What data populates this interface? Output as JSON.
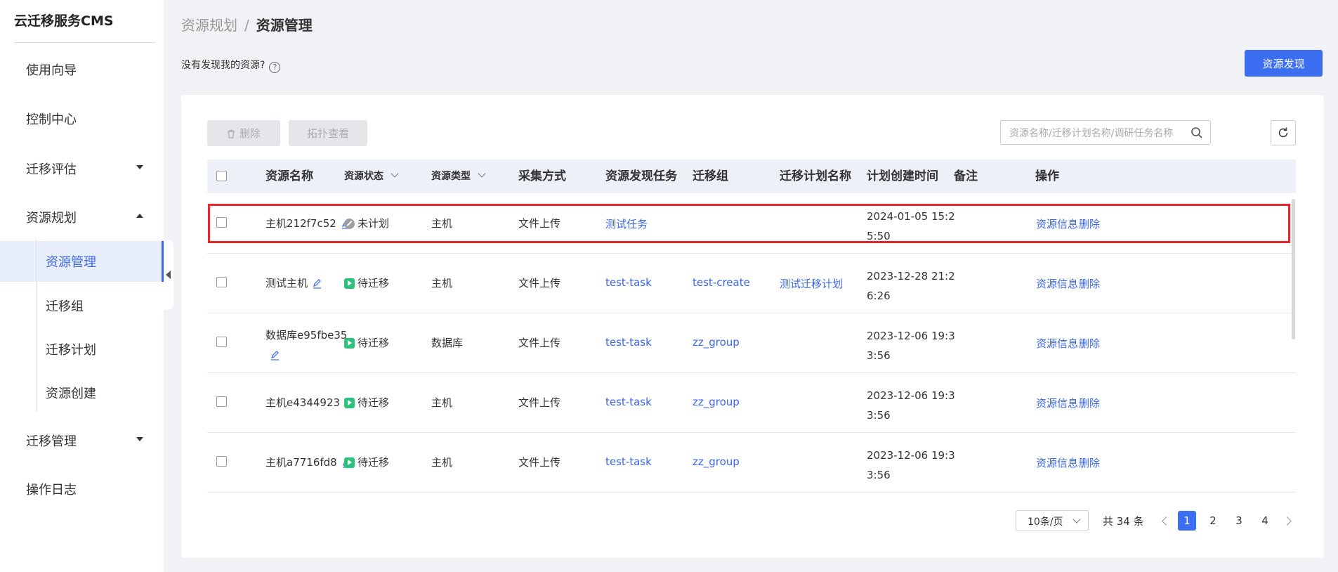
{
  "app": {
    "brand": "云迁移服务CMS"
  },
  "sidebar": {
    "items": [
      {
        "label": "使用向导"
      },
      {
        "label": "控制中心"
      },
      {
        "label": "迁移评估"
      },
      {
        "label": "资源规划"
      },
      {
        "label": "迁移管理"
      },
      {
        "label": "操作日志"
      }
    ],
    "sub_items": [
      {
        "label": "资源管理"
      },
      {
        "label": "迁移组"
      },
      {
        "label": "迁移计划"
      },
      {
        "label": "资源创建"
      }
    ]
  },
  "breadcrumb": {
    "parent": "资源规划",
    "separator": "/",
    "current": "资源管理"
  },
  "hint": {
    "text": "没有发现我的资源?",
    "help": "?"
  },
  "toolbar": {
    "discover_label": "资源发现",
    "delete_label": "删除",
    "topology_label": "拓扑查看",
    "search_placeholder": "资源名称/迁移计划名称/调研任务名称"
  },
  "table": {
    "headers": {
      "name": "资源名称",
      "status": "资源状态",
      "type": "资源类型",
      "collect": "采集方式",
      "task": "资源发现任务",
      "group": "迁移组",
      "plan": "迁移计划名称",
      "time": "计划创建时间",
      "note": "备注",
      "ops": "操作"
    },
    "rows": [
      {
        "name": "主机212f7c52",
        "status": "未计划",
        "type": "主机",
        "collect": "文件上传",
        "task": "测试任务",
        "group": "",
        "plan": "",
        "time_1": "2024-01-05 15:2",
        "time_2": "5:50",
        "op_info": "资源信息",
        "op_delete": "删除"
      },
      {
        "name": "测试主机",
        "status": "待迁移",
        "type": "主机",
        "collect": "文件上传",
        "task": "test-task",
        "group": "test-create",
        "plan": "测试迁移计划",
        "time_1": "2023-12-28 21:2",
        "time_2": "6:26",
        "op_info": "资源信息",
        "op_delete": "删除"
      },
      {
        "name": "数据库e95fbe35",
        "status": "待迁移",
        "type": "数据库",
        "collect": "文件上传",
        "task": "test-task",
        "group": "zz_group",
        "plan": "",
        "time_1": "2023-12-06 19:3",
        "time_2": "3:56",
        "op_info": "资源信息",
        "op_delete": "删除"
      },
      {
        "name": "主机e4344923",
        "status": "待迁移",
        "type": "主机",
        "collect": "文件上传",
        "task": "test-task",
        "group": "zz_group",
        "plan": "",
        "time_1": "2023-12-06 19:3",
        "time_2": "3:56",
        "op_info": "资源信息",
        "op_delete": "删除"
      },
      {
        "name": "主机a7716fd8",
        "status": "待迁移",
        "type": "主机",
        "collect": "文件上传",
        "task": "test-task",
        "group": "zz_group",
        "plan": "",
        "time_1": "2023-12-06 19:3",
        "time_2": "3:56",
        "op_info": "资源信息",
        "op_delete": "删除"
      }
    ]
  },
  "pagination": {
    "page_size": "10条/页",
    "total": "共 34 条",
    "pages": [
      "1",
      "2",
      "3",
      "4"
    ],
    "current": "1"
  },
  "colors": {
    "accent": "#3b6ef0",
    "highlight": "#e8262a",
    "status_pending": "#2bc27c"
  }
}
